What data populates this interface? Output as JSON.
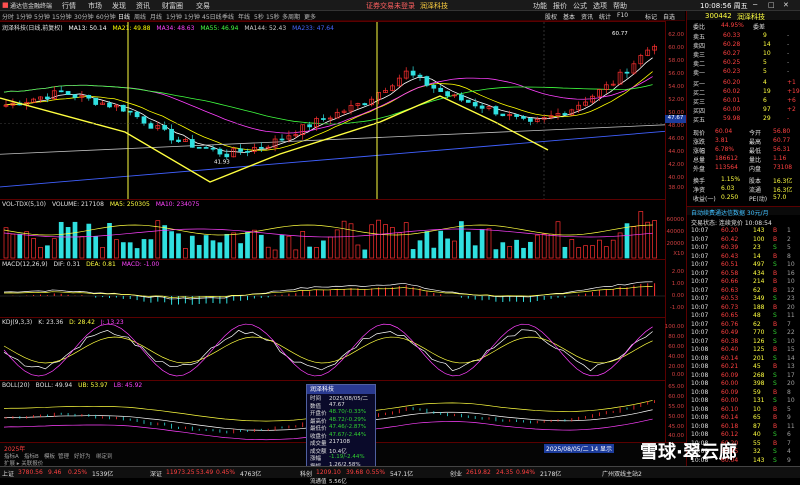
{
  "menu": {
    "app": "通达信金融终端",
    "items": [
      "行情",
      "市场",
      "发现",
      "资讯",
      "财富圈",
      "交易"
    ],
    "login": "证券交易未登录",
    "stock": "润泽科技",
    "right": [
      "功能",
      "报价",
      "公式",
      "选项",
      "帮助"
    ],
    "time": "10:08:56 周五"
  },
  "tabs": [
    "分时",
    "1分钟",
    "5分钟",
    "15分钟",
    "30分钟",
    "60分钟",
    "日线",
    "周线",
    "月线",
    "1分钟",
    "1分钟",
    "45日线",
    "季线",
    "年线",
    "5秒",
    "15秒",
    "多周期",
    "更多"
  ],
  "tool": [
    "股权",
    "基本",
    "资讯",
    "统计",
    "F10",
    "标记",
    "自选"
  ],
  "main": {
    "label": "润泽科技(日线,前复权)",
    "ma": [
      "MA13: 50.14",
      "MA21: 49.88",
      "MA34: 48.63",
      "MA55: 46.94",
      "MA144: 52.43",
      "MA233: 47.64"
    ],
    "high_label": "60.77",
    "low_label": "41.93",
    "price_tag": "47.67",
    "axis": [
      "62.00",
      "60.00",
      "58.00",
      "56.00",
      "54.00",
      "52.00",
      "50.00",
      "48.00",
      "46.00",
      "44.00",
      "42.00",
      "40.00",
      "38.00",
      "36.00"
    ]
  },
  "vol": {
    "label": "VOL-TDX(5,10)",
    "vals": [
      "VOLUME: 217108",
      "MA5: 250305",
      "MA10: 234075"
    ],
    "axis": [
      "60000",
      "40000",
      "20000",
      "X10"
    ]
  },
  "macd": {
    "label": "MACD(12,26,9)",
    "vals": [
      "DIF: 0.31",
      "DEA: 0.81",
      "MACD: -1.00"
    ],
    "axis": [
      "2.00",
      "1.00",
      "0.00",
      "-1.00"
    ]
  },
  "kdj": {
    "label": "KDJ(9,3,3)",
    "vals": [
      "K: 23.36",
      "D: 28.42",
      "J: 13.23"
    ],
    "axis": [
      "100.00",
      "80.00",
      "60.00",
      "40.00",
      "20.00",
      "0.00"
    ]
  },
  "boll": {
    "label": "BOLL(20)",
    "vals": [
      "BOLL: 49.94",
      "UB: 53.97",
      "LB: 45.92"
    ],
    "axis": [
      "65.00",
      "60.00",
      "55.00",
      "50.00",
      "45.00",
      "40.00"
    ]
  },
  "bottom_tabs": [
    "指标A",
    "指标B",
    "模板",
    "管理",
    "好好为",
    "绑定到"
  ],
  "bottom_label": "扩展 ▸ 关联报价",
  "year_label": "2025年",
  "date_tag": "2025/08/05/二 14 显示",
  "quote": {
    "code": "300442",
    "name": "润泽科技",
    "webi": "委比",
    "webi_v": "44.95%",
    "wcha": "委差",
    "wcha_v": "-",
    "sells": [
      [
        "卖五",
        "60.33",
        "9",
        "-"
      ],
      [
        "卖四",
        "60.28",
        "14",
        "-"
      ],
      [
        "卖三",
        "60.27",
        "10",
        "-"
      ],
      [
        "卖二",
        "60.25",
        "5",
        "-"
      ],
      [
        "卖一",
        "60.23",
        "5",
        "-"
      ]
    ],
    "buys": [
      [
        "买一",
        "60.20",
        "4",
        "+1"
      ],
      [
        "买二",
        "60.02",
        "19",
        "+19"
      ],
      [
        "买三",
        "60.01",
        "6",
        "+6"
      ],
      [
        "买四",
        "60.00",
        "97",
        "+2"
      ],
      [
        "买五",
        "59.98",
        "29",
        "-"
      ]
    ],
    "stats": [
      [
        "现价",
        "60.04",
        "今开",
        "56.80"
      ],
      [
        "涨跌",
        "3.81",
        "最高",
        "60.77"
      ],
      [
        "涨幅",
        "6.78%",
        "最低",
        "56.31"
      ],
      [
        "总量",
        "186612",
        "量比",
        "1.16"
      ],
      [
        "外盘",
        "113564",
        "内盘",
        "73108"
      ]
    ],
    "stats2": [
      [
        "换手",
        "1.15%",
        "股本",
        "16.3亿"
      ],
      [
        "净资",
        "6.03",
        "流通",
        "16.3亿"
      ],
      [
        "收益(一)",
        "0.250",
        "PE(动)",
        "57.0"
      ]
    ],
    "auto": "自动续费通达信数据 30元/月",
    "trade_label": "交易状态: 连续竞价 10:08:54",
    "ticks": [
      [
        "10:07",
        "60.20",
        "143",
        "B",
        "1"
      ],
      [
        "10:07",
        "60.42",
        "100",
        "B",
        "2"
      ],
      [
        "10:07",
        "60.39",
        "23",
        "S",
        "5"
      ],
      [
        "10:07",
        "60.43",
        "14",
        "B",
        "8"
      ],
      [
        "10:07",
        "60.51",
        "497",
        "S",
        "10"
      ],
      [
        "10:07",
        "60.58",
        "434",
        "B",
        "16"
      ],
      [
        "10:07",
        "60.66",
        "214",
        "B",
        "10"
      ],
      [
        "10:07",
        "60.63",
        "62",
        "B",
        "12"
      ],
      [
        "10:07",
        "60.53",
        "349",
        "S",
        "23"
      ],
      [
        "10:07",
        "60.73",
        "188",
        "B",
        "20"
      ],
      [
        "10:07",
        "60.65",
        "48",
        "S",
        "11"
      ],
      [
        "10:07",
        "60.76",
        "62",
        "B",
        "7"
      ],
      [
        "10:07",
        "60.49",
        "770",
        "S",
        "22"
      ],
      [
        "10:07",
        "60.38",
        "126",
        "S",
        "10"
      ],
      [
        "10:08",
        "60.40",
        "125",
        "B",
        "15"
      ],
      [
        "10:08",
        "60.14",
        "201",
        "S",
        "14"
      ],
      [
        "10:08",
        "60.21",
        "45",
        "B",
        "13"
      ],
      [
        "10:08",
        "60.09",
        "268",
        "S",
        "17"
      ],
      [
        "10:08",
        "60.00",
        "398",
        "S",
        "20"
      ],
      [
        "10:08",
        "60.09",
        "59",
        "B",
        "8"
      ],
      [
        "10:08",
        "60.00",
        "131",
        "S",
        "10"
      ],
      [
        "10:08",
        "60.10",
        "10",
        "B",
        "5"
      ],
      [
        "10:08",
        "60.14",
        "65",
        "B",
        "9"
      ],
      [
        "10:08",
        "60.18",
        "87",
        "B",
        "11"
      ],
      [
        "10:08",
        "60.12",
        "40",
        "S",
        "6"
      ],
      [
        "10:08",
        "60.20",
        "55",
        "B",
        "7"
      ],
      [
        "10:08",
        "60.15",
        "32",
        "S",
        "4"
      ],
      [
        "10:08",
        "60.04",
        "143",
        "S",
        "9"
      ]
    ]
  },
  "popup": {
    "title": "润泽科技",
    "rows": [
      [
        "时间",
        "2025/08/05/二"
      ],
      [
        "数值",
        "47.67"
      ],
      [
        "开盘价",
        "48.70/-0.33%"
      ],
      [
        "最高价",
        "48.72/-0.29%"
      ],
      [
        "最低价",
        "47.46/-2.87%"
      ],
      [
        "收盘价",
        "47.67/-2.44%"
      ],
      [
        "成交量",
        "217108"
      ],
      [
        "成交额",
        "10.4亿"
      ],
      [
        "涨幅",
        "-1.19/-2.44%"
      ],
      [
        "振幅",
        "1.26/2.58%"
      ],
      [
        "换手率",
        "3.92%"
      ],
      [
        "流通值",
        "5.56亿"
      ]
    ]
  },
  "status": [
    [
      "上证",
      "3780.56",
      "9.46",
      "0.25%",
      "1539亿"
    ],
    [
      "深证",
      "11973.25",
      "53.49",
      "0.45%",
      "4763亿"
    ],
    [
      "科创",
      "1209.10",
      "39.68",
      "0.55%",
      "547.1亿"
    ],
    [
      "创业",
      "2619.82",
      "24.35",
      "0.94%",
      "2178亿"
    ]
  ],
  "status_right": "广州双线主站2",
  "watermark": "雪球·翠云廊",
  "colors": {
    "up": "#ff3030",
    "down": "#30e0e0",
    "ma13": "#ffffff",
    "ma21": "#ffff00",
    "ma34": "#ff40ff",
    "ma55": "#40ff40",
    "ma144": "#c0c0c0",
    "ma233": "#4060ff"
  }
}
